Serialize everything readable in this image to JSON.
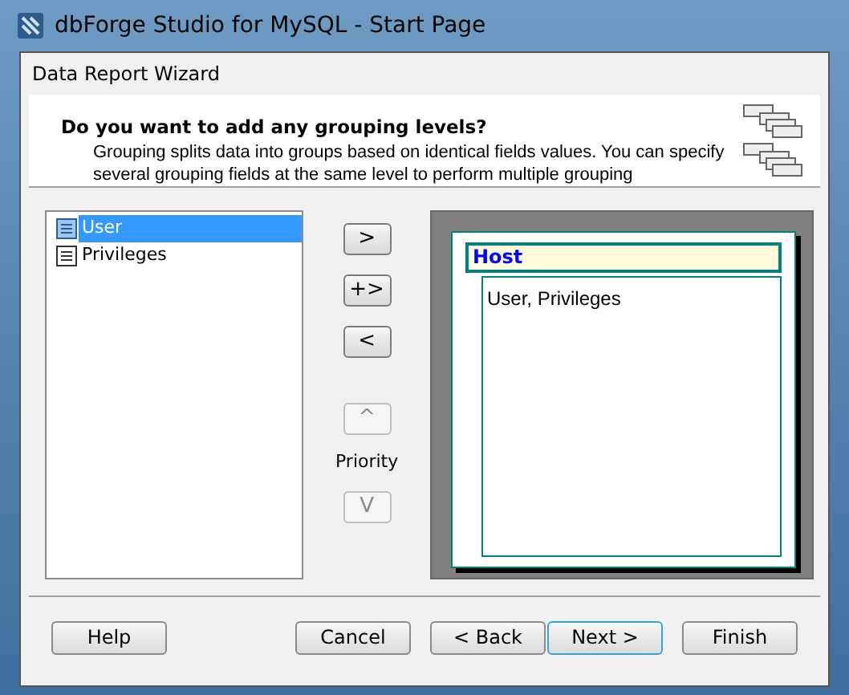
{
  "window": {
    "title": "dbForge Studio for MySQL - Start Page"
  },
  "dialog": {
    "title": "Data Report Wizard"
  },
  "header": {
    "heading": "Do you want to add any grouping levels?",
    "description": "Grouping splits data into groups based on identical fields values. You can specify several grouping fields at the same level to perform multiple grouping"
  },
  "fields": [
    {
      "label": "User",
      "selected": true
    },
    {
      "label": "Privileges",
      "selected": false
    }
  ],
  "move_buttons": [
    {
      "label": ">",
      "disabled": false
    },
    {
      "label": "+>",
      "disabled": false
    },
    {
      "label": "<",
      "disabled": false
    }
  ],
  "priority": {
    "label": "Priority",
    "up": {
      "label": "^",
      "disabled": true
    },
    "down": {
      "label": "V",
      "disabled": true
    }
  },
  "preview": {
    "group": "Host",
    "detail": "User, Privileges"
  },
  "buttons": [
    {
      "label": "Help",
      "default": false
    },
    {
      "label": "Cancel",
      "default": false
    },
    {
      "label": "< Back",
      "default": false
    },
    {
      "label": "Next >",
      "default": true
    },
    {
      "label": "Finish",
      "default": false
    }
  ]
}
